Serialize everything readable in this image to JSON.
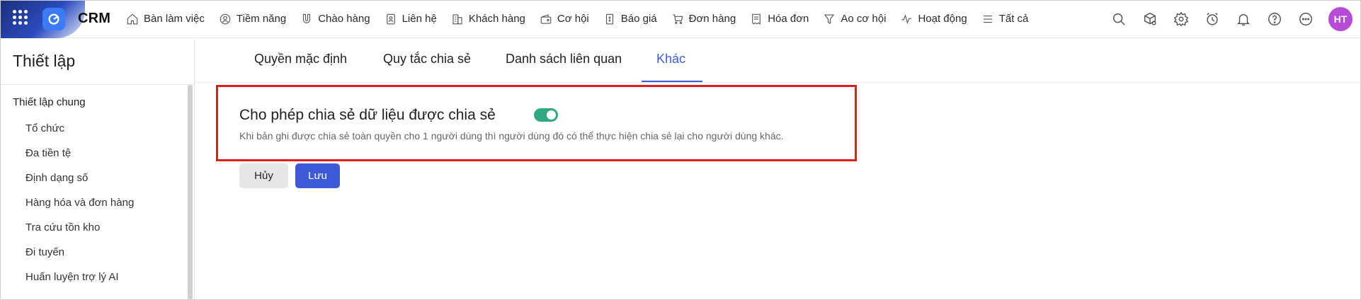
{
  "brand": {
    "name": "CRM"
  },
  "nav": {
    "items": [
      {
        "label": "Bàn làm việc",
        "icon": "home-icon"
      },
      {
        "label": "Tiềm năng",
        "icon": "target-person-icon"
      },
      {
        "label": "Chào hàng",
        "icon": "magnet-icon"
      },
      {
        "label": "Liên hệ",
        "icon": "contact-icon"
      },
      {
        "label": "Khách hàng",
        "icon": "building-icon"
      },
      {
        "label": "Cơ hội",
        "icon": "wallet-icon"
      },
      {
        "label": "Báo giá",
        "icon": "quote-icon"
      },
      {
        "label": "Đơn hàng",
        "icon": "cart-icon"
      },
      {
        "label": "Hóa đơn",
        "icon": "invoice-icon"
      },
      {
        "label": "Ao cơ hội",
        "icon": "funnel-icon"
      },
      {
        "label": "Hoạt động",
        "icon": "activity-icon"
      },
      {
        "label": "Tất cả",
        "icon": "menu-icon"
      }
    ]
  },
  "header_right": {
    "avatar_initials": "HT",
    "avatar_color": "#b54bd6",
    "icons": [
      "search-icon",
      "package-search-icon",
      "gear-icon",
      "alarm-icon",
      "bell-icon",
      "help-icon",
      "more-icon"
    ]
  },
  "sidebar": {
    "title": "Thiết lập",
    "group_title": "Thiết lập chung",
    "items": [
      "Tổ chức",
      "Đa tiền tệ",
      "Định dạng số",
      "Hàng hóa và đơn hàng",
      "Tra cứu tồn kho",
      "Đi tuyến",
      "Huấn luyện trợ lý AI"
    ]
  },
  "tabs": [
    {
      "label": "Quyền mặc định",
      "active": false
    },
    {
      "label": "Quy tắc chia sẻ",
      "active": false
    },
    {
      "label": "Danh sách liên quan",
      "active": false
    },
    {
      "label": "Khác",
      "active": true
    }
  ],
  "setting": {
    "title": "Cho phép chia sẻ dữ liệu được chia sẻ",
    "enabled": true,
    "description": "Khi bản ghi được chia sẻ toàn quyền cho 1 người dùng thì người dùng đó có thể thực hiện chia sẻ lại cho người dùng khác."
  },
  "buttons": {
    "cancel": "Hủy",
    "save": "Lưu"
  },
  "colors": {
    "accent": "#3d5bd9",
    "toggle_on": "#2ea984",
    "highlight": "#e01c1c"
  }
}
